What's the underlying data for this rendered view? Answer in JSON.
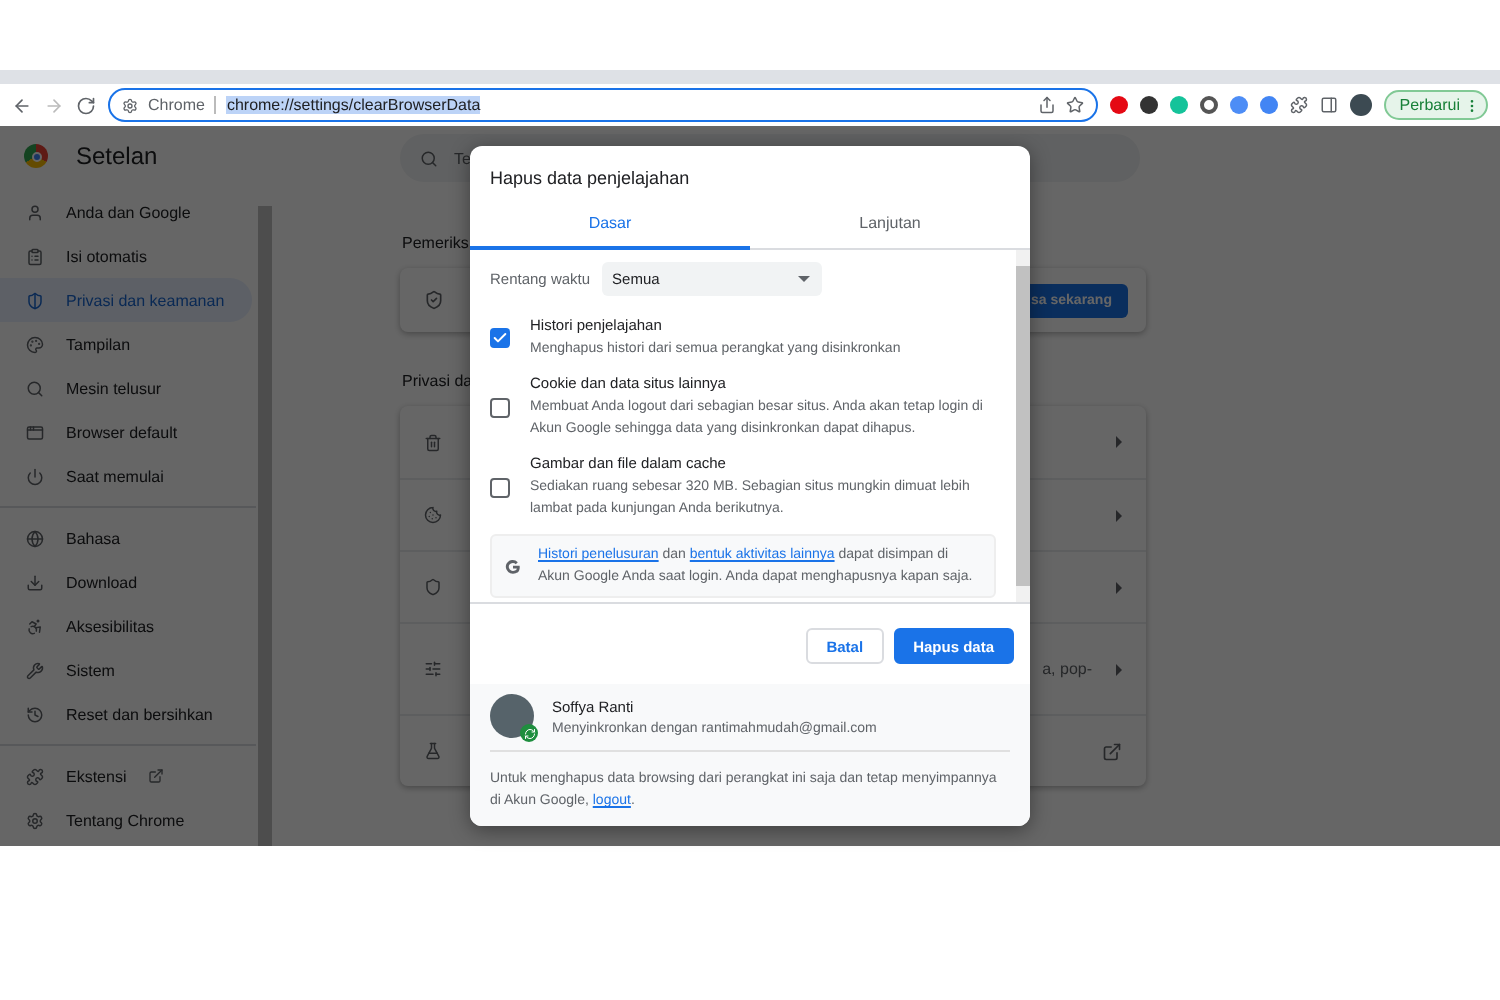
{
  "browser": {
    "site_label": "Chrome",
    "url": "chrome://settings/clearBrowserData",
    "update_button": "Perbarui"
  },
  "settings": {
    "title": "Setelan",
    "search_placeholder": "Te",
    "sidebar": {
      "sections": [
        [
          {
            "label": "Anda dan Google",
            "kind": "page",
            "selected": false
          },
          {
            "label": "Isi otomatis",
            "kind": "page",
            "selected": false
          },
          {
            "label": "Privasi dan keamanan",
            "kind": "page",
            "selected": true
          },
          {
            "label": "Tampilan",
            "kind": "page",
            "selected": false
          },
          {
            "label": "Mesin telusur",
            "kind": "page",
            "selected": false
          },
          {
            "label": "Browser default",
            "kind": "page",
            "selected": false
          },
          {
            "label": "Saat memulai",
            "kind": "page",
            "selected": false
          }
        ],
        [
          {
            "label": "Bahasa",
            "kind": "page",
            "selected": false
          },
          {
            "label": "Download",
            "kind": "page",
            "selected": false
          },
          {
            "label": "Aksesibilitas",
            "kind": "page",
            "selected": false
          },
          {
            "label": "Sistem",
            "kind": "page",
            "selected": false
          },
          {
            "label": "Reset dan bersihkan",
            "kind": "page",
            "selected": false
          }
        ],
        [
          {
            "label": "Ekstensi",
            "kind": "external",
            "selected": false
          },
          {
            "label": "Tentang Chrome",
            "kind": "page",
            "selected": false
          }
        ]
      ]
    },
    "safety_section": {
      "heading": "Pemeriks",
      "button": "sa sekarang"
    },
    "privacy_section": {
      "heading": "Privasi da",
      "rows": [
        {
          "text": "",
          "kind": "arrow"
        },
        {
          "text": "",
          "kind": "arrow"
        },
        {
          "text": "",
          "kind": "arrow"
        },
        {
          "text": "a, pop-",
          "kind": "arrow"
        },
        {
          "text": "",
          "kind": "external"
        }
      ]
    }
  },
  "dialog": {
    "title": "Hapus data penjelajahan",
    "tabs": [
      {
        "label": "Dasar",
        "selected": true
      },
      {
        "label": "Lanjutan",
        "selected": false
      }
    ],
    "time_range": {
      "label": "Rentang waktu",
      "value": "Semua"
    },
    "options": [
      {
        "title": "Histori penjelajahan",
        "description": "Menghapus histori dari semua perangkat yang disinkronkan",
        "checked": true
      },
      {
        "title": "Cookie dan data situs lainnya",
        "description": "Membuat Anda logout dari sebagian besar situs. Anda akan tetap login di Akun Google sehingga data yang disinkronkan dapat dihapus.",
        "checked": false
      },
      {
        "title": "Gambar dan file dalam cache",
        "description": "Sediakan ruang sebesar 320 MB. Sebagian situs mungkin dimuat lebih lambat pada kunjungan Anda berikutnya.",
        "checked": false
      }
    ],
    "info": [
      {
        "text": "Histori penelusuran",
        "kind": "link"
      },
      {
        "text": " dan ",
        "kind": "text"
      },
      {
        "text": "bentuk aktivitas lainnya",
        "kind": "link"
      },
      {
        "text": " dapat disimpan di Akun Google Anda saat login. Anda dapat menghapusnya kapan saja.",
        "kind": "text"
      }
    ],
    "cancel_button": "Batal",
    "confirm_button": "Hapus data",
    "account": {
      "name": "Soffya Ranti",
      "status": "Menyinkronkan dengan rantimahmudah@gmail.com"
    },
    "footer_note": [
      {
        "text": "Untuk menghapus data browsing dari perangkat ini saja dan tetap menyimpannya di Akun Google, ",
        "kind": "text"
      },
      {
        "text": "logout",
        "kind": "link"
      },
      {
        "text": ".",
        "kind": "text"
      }
    ]
  }
}
